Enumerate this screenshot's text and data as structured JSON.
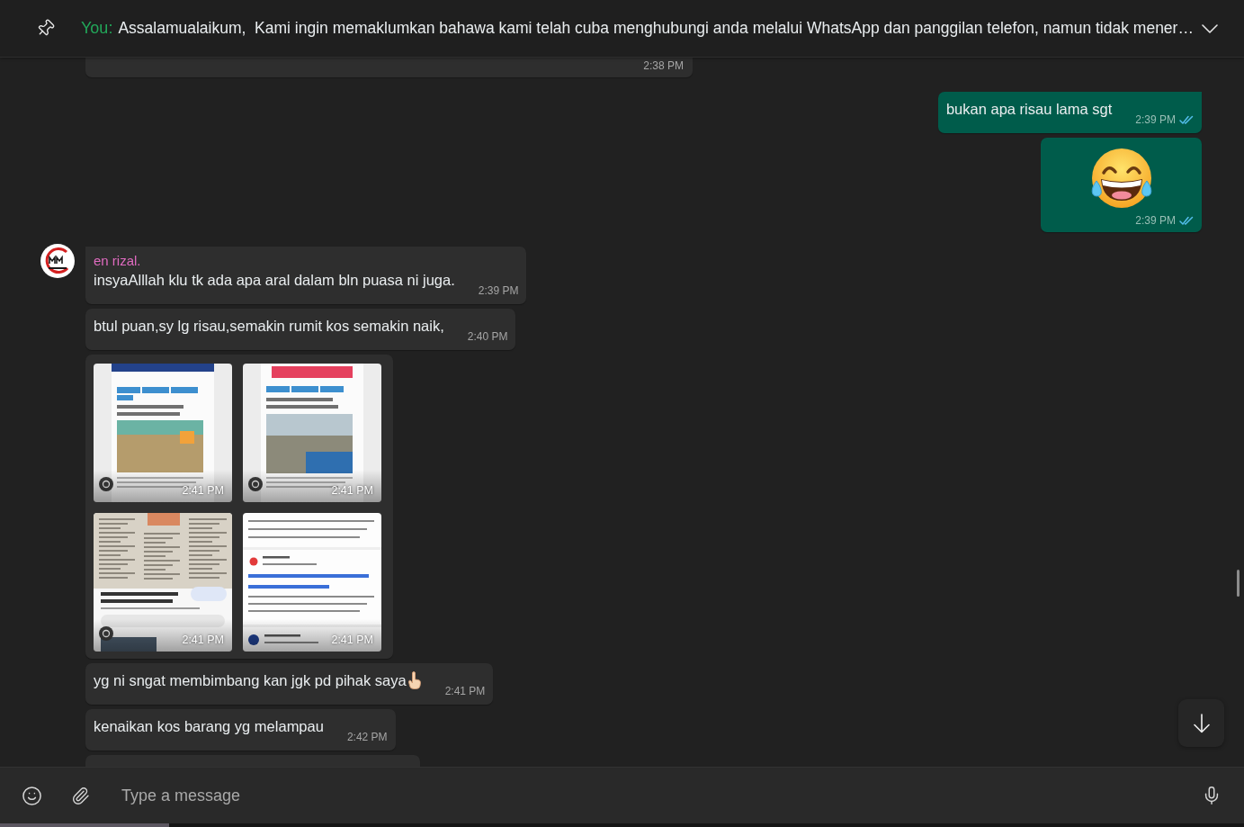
{
  "pinned_message": {
    "sender": "You:",
    "text": "Assalamualaikum,  Kami ingin memaklumkan bahawa kami telah cuba menghubungi anda melalui WhatsApp dan panggilan telefon, namun tidak mener…"
  },
  "messages": [
    {
      "kind": "partial",
      "outgoing": false,
      "time": "2:38 PM"
    },
    {
      "kind": "text",
      "outgoing": true,
      "text": "bukan apa risau lama sgt",
      "time": "2:39 PM",
      "read": true
    },
    {
      "kind": "sticker",
      "outgoing": true,
      "time": "2:39 PM",
      "read": true
    },
    {
      "kind": "text",
      "outgoing": false,
      "sender": {
        "name": "en rizal.",
        "color": "#e06bc0"
      },
      "text": "insyaAlllah klu tk ada apa aral dalam bln puasa ni juga.",
      "time": "2:39 PM"
    },
    {
      "kind": "text",
      "outgoing": false,
      "text": "btul puan,sy lg risau,semakin rumit kos semakin naik,",
      "time": "2:40 PM"
    },
    {
      "kind": "images",
      "outgoing": false,
      "images": [
        {
          "time": "2:41 PM"
        },
        {
          "time": "2:41 PM"
        },
        {
          "time": "2:41 PM"
        },
        {
          "time": "2:41 PM"
        }
      ]
    },
    {
      "kind": "text",
      "outgoing": false,
      "text": "yg ni sngat membimbang kan jgk pd pihak saya",
      "emoji": {
        "kind": "pointing-up"
      },
      "time": "2:41 PM"
    },
    {
      "kind": "text",
      "outgoing": false,
      "text": "kenaikan kos barang yg melampau",
      "time": "2:42 PM"
    },
    {
      "kind": "partial",
      "outgoing": false
    }
  ],
  "composer": {
    "placeholder": "Type a message"
  }
}
